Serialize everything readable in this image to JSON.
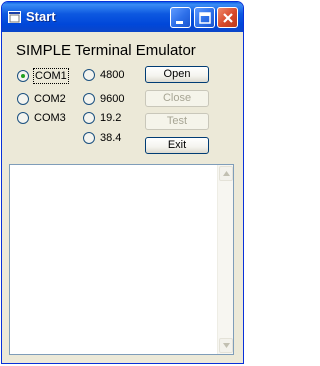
{
  "window": {
    "title": "Start",
    "controls": {
      "minimize": "minimize-icon",
      "maximize": "maximize-icon",
      "close": "close-icon"
    }
  },
  "app": {
    "title": "SIMPLE Terminal Emulator"
  },
  "ports": {
    "selected": "COM1",
    "options": [
      "COM1",
      "COM2",
      "COM3"
    ]
  },
  "baud": {
    "selected": "",
    "options": [
      "4800",
      "9600",
      "19.2",
      "38.4"
    ]
  },
  "buttons": {
    "open": "Open",
    "close": "Close",
    "test": "Test",
    "exit": "Exit"
  },
  "output": {
    "text": ""
  },
  "colors": {
    "titlebar": "#0054e3",
    "window_bg": "#ece9d8",
    "radio_dot": "#21a121",
    "close_button": "#d8482a"
  }
}
